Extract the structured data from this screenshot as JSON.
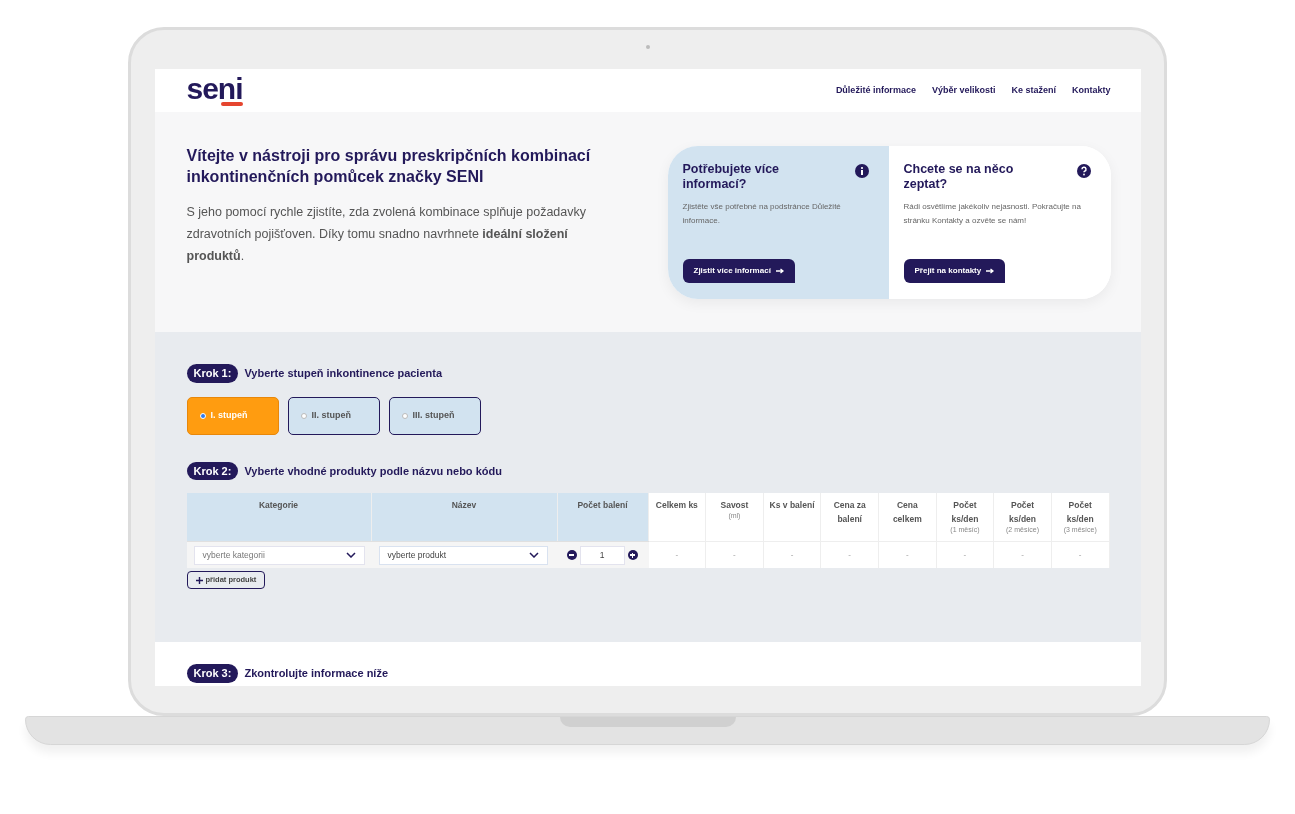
{
  "header": {
    "logo": "seni",
    "nav": [
      {
        "label": "Důležité informace"
      },
      {
        "label": "Výběr velikosti"
      },
      {
        "label": "Ke stažení"
      },
      {
        "label": "Kontakty"
      }
    ]
  },
  "hero": {
    "title": "Vítejte v nástroji pro správu preskripčních kombinací inkontinenčních pomůcek značky SENI",
    "text": "S jeho pomocí rychle zjistíte, zda zvolená kombinace splňuje požadavky zdravotních pojišťoven. Díky tomu snadno navrhnete **ideální složení produktů**."
  },
  "info_cards": [
    {
      "kind": "info",
      "title": "Potřebujete více informací?",
      "text": "Zjistěte vše potřebné na podstránce Důležité informace.",
      "button": "Zjistit více informací"
    },
    {
      "kind": "question",
      "title": "Chcete se na něco zeptat?",
      "text": "Rádi osvětlíme jakékoliv nejasnosti. Pokračujte na stránku Kontakty a ozvěte se nám!",
      "button": "Přejít na kontakty"
    }
  ],
  "step1": {
    "badge": "Krok 1:",
    "title": "Vyberte stupeň inkontinence pacienta",
    "options": [
      {
        "label": "I. stupeň",
        "selected": true
      },
      {
        "label": "II. stupeň",
        "selected": false
      },
      {
        "label": "III. stupeň",
        "selected": false
      }
    ]
  },
  "step2": {
    "badge": "Krok 2:",
    "title": "Vyberte vhodné produkty podle názvu nebo kódu",
    "table": {
      "columns": [
        {
          "label": "Kategorie"
        },
        {
          "label": "Název"
        },
        {
          "label": "Počet balení"
        },
        {
          "label": "Celkem ks"
        },
        {
          "label": "Savost",
          "sublabel": "(ml)"
        },
        {
          "label": "Ks v balení"
        },
        {
          "label": "Cena za balení"
        },
        {
          "label": "Cena celkem"
        },
        {
          "label": "Počet ks/den",
          "sublabel": "(1 měsíc)"
        },
        {
          "label": "Počet ks/den",
          "sublabel": "(2 měsíce)"
        },
        {
          "label": "Počet ks/den",
          "sublabel": "(3 měsíce)"
        }
      ],
      "row": {
        "category": "vyberte kategorii",
        "product": "vyberte produkt",
        "quantity": "1",
        "cells": [
          "-",
          "-",
          "-",
          "-",
          "-",
          "-",
          "-",
          "-"
        ]
      }
    },
    "add_button": "přidat produkt"
  },
  "step3": {
    "badge": "Krok 3:",
    "title": "Zkontrolujte informace níže"
  }
}
